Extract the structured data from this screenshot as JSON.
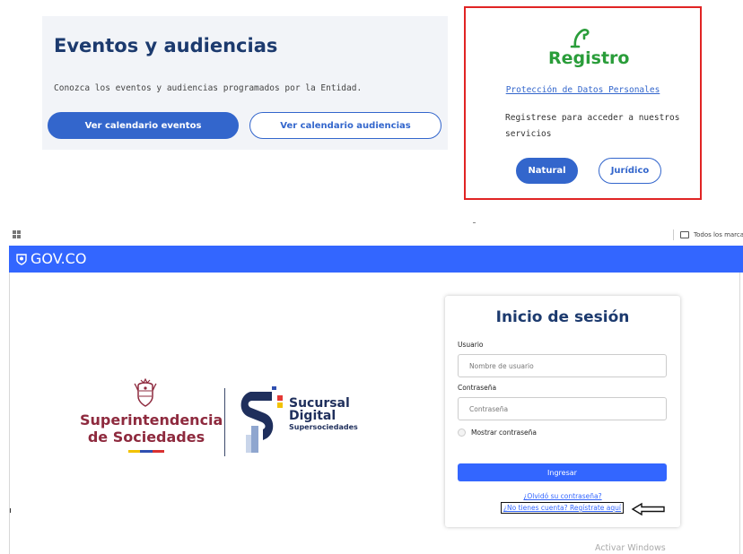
{
  "events": {
    "title": "Eventos y audiencias",
    "description": "Conozca los eventos y audiencias programados por la Entidad.",
    "btn_events": "Ver calendario eventos",
    "btn_hearings": "Ver calendario audiencias"
  },
  "registro": {
    "title": "Registro",
    "privacy_link": "Protección de Datos Personales",
    "text": "Registrese para acceder a nuestros servicios",
    "btn_natural": "Natural",
    "btn_juridico": "Jurídico"
  },
  "browser": {
    "bookmarks_all": "Todos los marcadores",
    "gov_label": "GOV.CO"
  },
  "logos": {
    "supersociedades_line1": "Superintendencia",
    "supersociedades_line2": "de Sociedades",
    "sucursal_line1": "Sucursal",
    "sucursal_line2": "Digital",
    "sucursal_line3": "Supersociedades"
  },
  "login": {
    "title": "Inicio de sesión",
    "user_label": "Usuario",
    "user_placeholder": "Nombre de usuario",
    "password_label": "Contraseña",
    "password_placeholder": "Contraseña",
    "show_password": "Mostrar contraseña",
    "submit": "Ingresar",
    "forgot": "¿Olvidó su contraseña?",
    "register": "¿No tienes cuenta? Regístrate aquí"
  },
  "watermark": "Activar Windows",
  "colors": {
    "primary_blue": "#3366cc",
    "gov_blue": "#3366ff",
    "registro_green": "#2a9d3a",
    "highlight_red": "#e02424",
    "supersoc_maroon": "#8e2a3e"
  }
}
